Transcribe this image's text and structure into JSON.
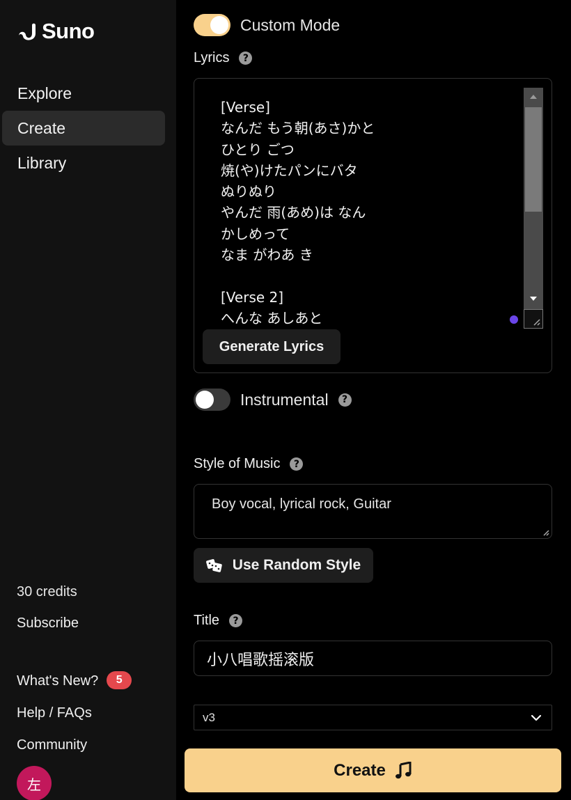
{
  "sidebar": {
    "logo_text": "Suno",
    "nav": [
      {
        "label": "Explore"
      },
      {
        "label": "Create"
      },
      {
        "label": "Library"
      }
    ],
    "credits": "30 credits",
    "subscribe": "Subscribe",
    "whats_new": "What's New?",
    "whats_new_badge": "5",
    "help": "Help / FAQs",
    "community": "Community",
    "avatar_initial": "左"
  },
  "form": {
    "custom_mode_label": "Custom Mode",
    "custom_mode_on": true,
    "lyrics_label": "Lyrics",
    "lyrics_value": "[Verse]\nなんだ もう朝(あさ)かと\nひとり ごつ\n焼(や)けたパンにバタ\nぬりぬり\nやんだ 雨(あめ)は なん\nかしめって\nなま がわあ き\n\n[Verse 2]\nへんな あしあと",
    "generate_lyrics_label": "Generate Lyrics",
    "instrumental_label": "Instrumental",
    "instrumental_on": false,
    "style_label": "Style of Music",
    "style_value": "Boy vocal, lyrical rock, Guitar",
    "random_style_label": "Use Random Style",
    "title_label": "Title",
    "title_value": "小八唱歌摇滚版",
    "model_value": "v3",
    "create_label": "Create"
  },
  "colors": {
    "accent": "#f9d18c",
    "sidebar_bg": "#121212",
    "badge": "#e5484d",
    "avatar": "#c2185b"
  }
}
